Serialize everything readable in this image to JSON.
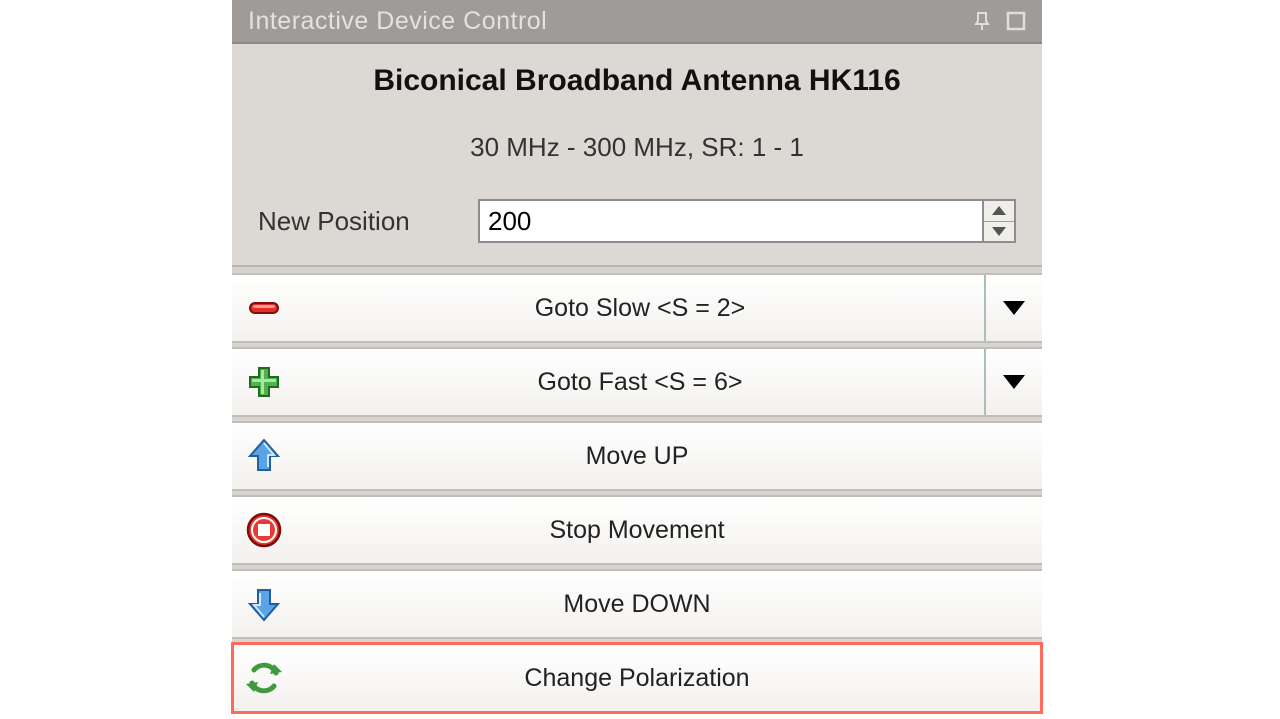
{
  "titlebar": {
    "title": "Interactive Device Control"
  },
  "device": {
    "name": "Biconical Broadband Antenna HK116",
    "range": "30 MHz - 300 MHz, SR: 1 - 1"
  },
  "position": {
    "label": "New Position",
    "value": "200"
  },
  "buttons": {
    "goto_slow": "Goto Slow <S = 2>",
    "goto_fast": "Goto Fast <S = 6>",
    "move_up": "Move UP",
    "stop": "Stop Movement",
    "move_down": "Move DOWN",
    "change_pol": "Change Polarization"
  }
}
